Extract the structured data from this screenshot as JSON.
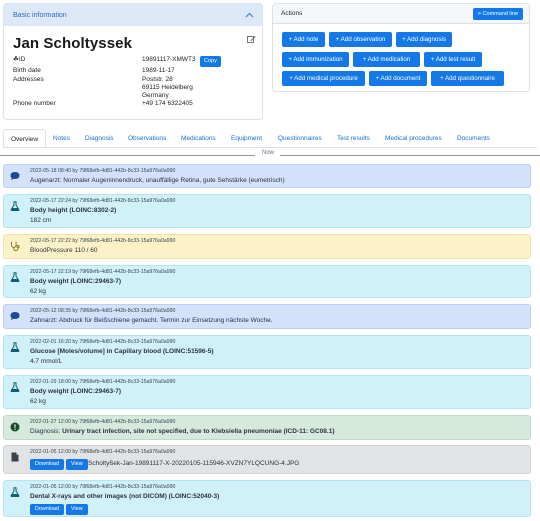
{
  "info": {
    "header": "Basic information",
    "name": "Jan Scholtyssek",
    "id_label": "☘ID",
    "id_value": "19891117-XMWT3",
    "copy_label": "Copy",
    "birth_label": "Birth date",
    "birth_value": "1989-11-17",
    "addresses_label": "Addresses",
    "address_lines": [
      "Poststr. 28",
      "69115 Heidelberg",
      "Germany"
    ],
    "phone_label": "Phone number",
    "phone_value": "+49 174 6322405"
  },
  "actions": {
    "title": "Actions",
    "command_line": "> Command line",
    "buttons": [
      "+ Add note",
      "+ Add observation",
      "+ Add diagnosis",
      "+ Add immunization",
      "+ Add medication",
      "+ Add test result",
      "+ Add medical procedure",
      "+ Add document",
      "+ Add questionnaire"
    ]
  },
  "tabs": [
    "Overview",
    "Notes",
    "Diagnosis",
    "Observations",
    "Medications",
    "Equipment",
    "Questionnaires",
    "Test results",
    "Medical procedures",
    "Documents"
  ],
  "now_label": "Now",
  "items": [
    {
      "kind": "note",
      "color": "#d3e1fb",
      "icon": "speech-bubble-icon",
      "meta": "2022-05-18 08:40 by 79f68efb-4d81-442b-8c33-15a976a0a990",
      "text": "Augenarzt: Normaler Augeninnendruck, unauffällige Retina, gute Sehstärke (eumetrisch)"
    },
    {
      "kind": "test",
      "color": "#d0f0fa",
      "icon": "flask-icon",
      "meta": "2022-05-17 22:24 by 79f68efb-4d81-442b-8c33-15a976a0a990",
      "title": "Body height (LOINC:8302-2)",
      "value": "182 cm"
    },
    {
      "kind": "observation",
      "color": "#fdf1c8",
      "icon": "stethoscope-icon",
      "meta": "2022-05-17 22:22 by 79f68efb-4d81-442b-8c33-15a976a0a990",
      "text": "BloodPressure 110 / 60"
    },
    {
      "kind": "test",
      "color": "#d0f0fa",
      "icon": "flask-icon",
      "meta": "2022-05-17 22:19 by 79f68efb-4d81-442b-8c33-15a976a0a990",
      "title": "Body weight (LOINC:29463-7)",
      "value": "62 kg"
    },
    {
      "kind": "note",
      "color": "#d3e1fb",
      "icon": "speech-bubble-icon",
      "meta": "2022-05-12 08:35 by 79f68efb-4d81-442b-8c33-15a976a0a990",
      "text": "Zahnarzt: Abdruck für Beißschiene gemacht. Termin zur Einsetzung nächste Woche."
    },
    {
      "kind": "test",
      "color": "#d0f0fa",
      "icon": "flask-icon",
      "meta": "2022-02-01 16:20 by 79f68efb-4d81-442b-8c33-15a976a0a990",
      "title": "Glucose [Moles/volume] in Capillary blood (LOINC:51596-5)",
      "value": "4.7 mmol/L"
    },
    {
      "kind": "test",
      "color": "#d0f0fa",
      "icon": "flask-icon",
      "meta": "2022-01-29 18:00 by 79f68efb-4d81-442b-8c33-15a976a0a990",
      "title": "Body weight (LOINC:29463-7)",
      "value": "62 kg"
    },
    {
      "kind": "diagnosis",
      "color": "#d5e9dc",
      "icon": "alert-circle-icon",
      "meta": "2022-01-27 12:00 by 79f68efb-4d81-442b-8c33-15a976a0a990",
      "prefix": "Diagnosis: ",
      "title": "Urinary tract infection, site not specified, due to Klebsiella pneumoniae (ICD-11: GC08.1)"
    },
    {
      "kind": "document",
      "color": "#e2e3e5",
      "icon": "file-icon",
      "meta": "2022-01-05 12:00 by 79f68efb-4d81-442b-8c33-15a976a0a990",
      "download_label": "Download",
      "view_label": "View",
      "filename": "Scholtyßek-Jan-19891117-X-20220105-115946-XVZN7YLQCUNG-4.JPG"
    },
    {
      "kind": "test",
      "color": "#d0f0fa",
      "icon": "flask-icon",
      "meta": "2022-01-05 12:00 by 79f68efb-4d81-442b-8c33-15a976a0a990",
      "title": "Dental X-rays and other images (not DICOM) (LOINC:52040-3)",
      "download_label": "Download",
      "view_label": "View"
    }
  ]
}
